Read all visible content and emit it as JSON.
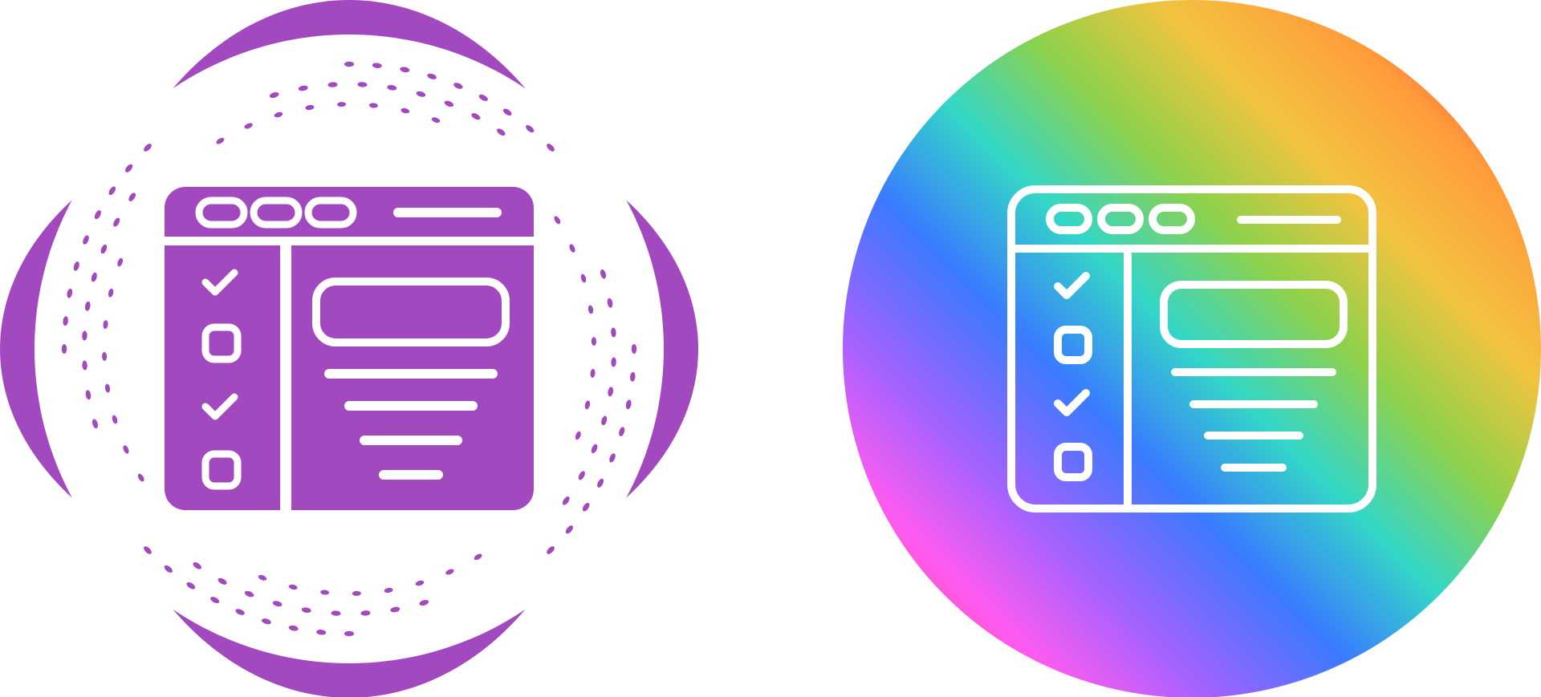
{
  "icons": [
    {
      "name": "checklist-browser-glyph-icon",
      "style": "glyph",
      "badge": "purple-ring-badge",
      "color": "#a349bf"
    },
    {
      "name": "checklist-browser-outline-icon",
      "style": "outline",
      "badge": "rainbow-gradient-circle",
      "gradient_colors": [
        "#ff3b3b",
        "#ff9c3b",
        "#f2c33f",
        "#8fd14a",
        "#33d6c8",
        "#3a7bff",
        "#9a63ff",
        "#ff5bf0",
        "#ff3b4f"
      ]
    }
  ],
  "checklist": {
    "rows": [
      {
        "state": "checked"
      },
      {
        "state": "unchecked"
      },
      {
        "state": "checked"
      },
      {
        "state": "unchecked"
      }
    ]
  }
}
